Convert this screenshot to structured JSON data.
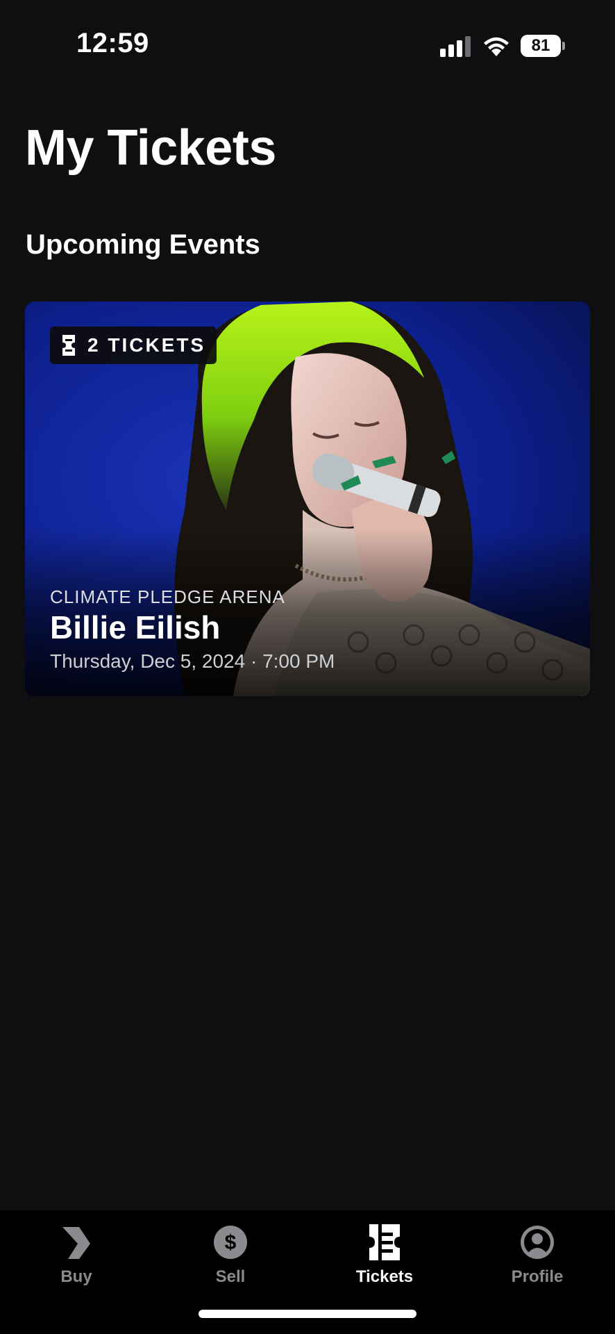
{
  "status_bar": {
    "time": "12:59",
    "battery": "81"
  },
  "header": {
    "title": "My Tickets"
  },
  "section": {
    "title": "Upcoming Events"
  },
  "events": [
    {
      "ticket_count": "2 TICKETS",
      "venue": "CLIMATE PLEDGE ARENA",
      "artist": "Billie Eilish",
      "date_time": "Thursday, Dec 5, 2024 · 7:00 PM",
      "image_icon": "performer-photo"
    }
  ],
  "tab_bar": {
    "items": [
      {
        "label": "Buy",
        "icon": "buy-icon",
        "active": false
      },
      {
        "label": "Sell",
        "icon": "dollar-icon",
        "active": false
      },
      {
        "label": "Tickets",
        "icon": "ticket-icon",
        "active": true
      },
      {
        "label": "Profile",
        "icon": "profile-icon",
        "active": false
      }
    ]
  },
  "colors": {
    "background": "#0f0f11",
    "tab_bar": "#000000",
    "inactive_tab": "#8a8a8f",
    "active_tab": "#ffffff",
    "card_blue": "#0b1f8a",
    "hair_green": "#9fe31a"
  }
}
